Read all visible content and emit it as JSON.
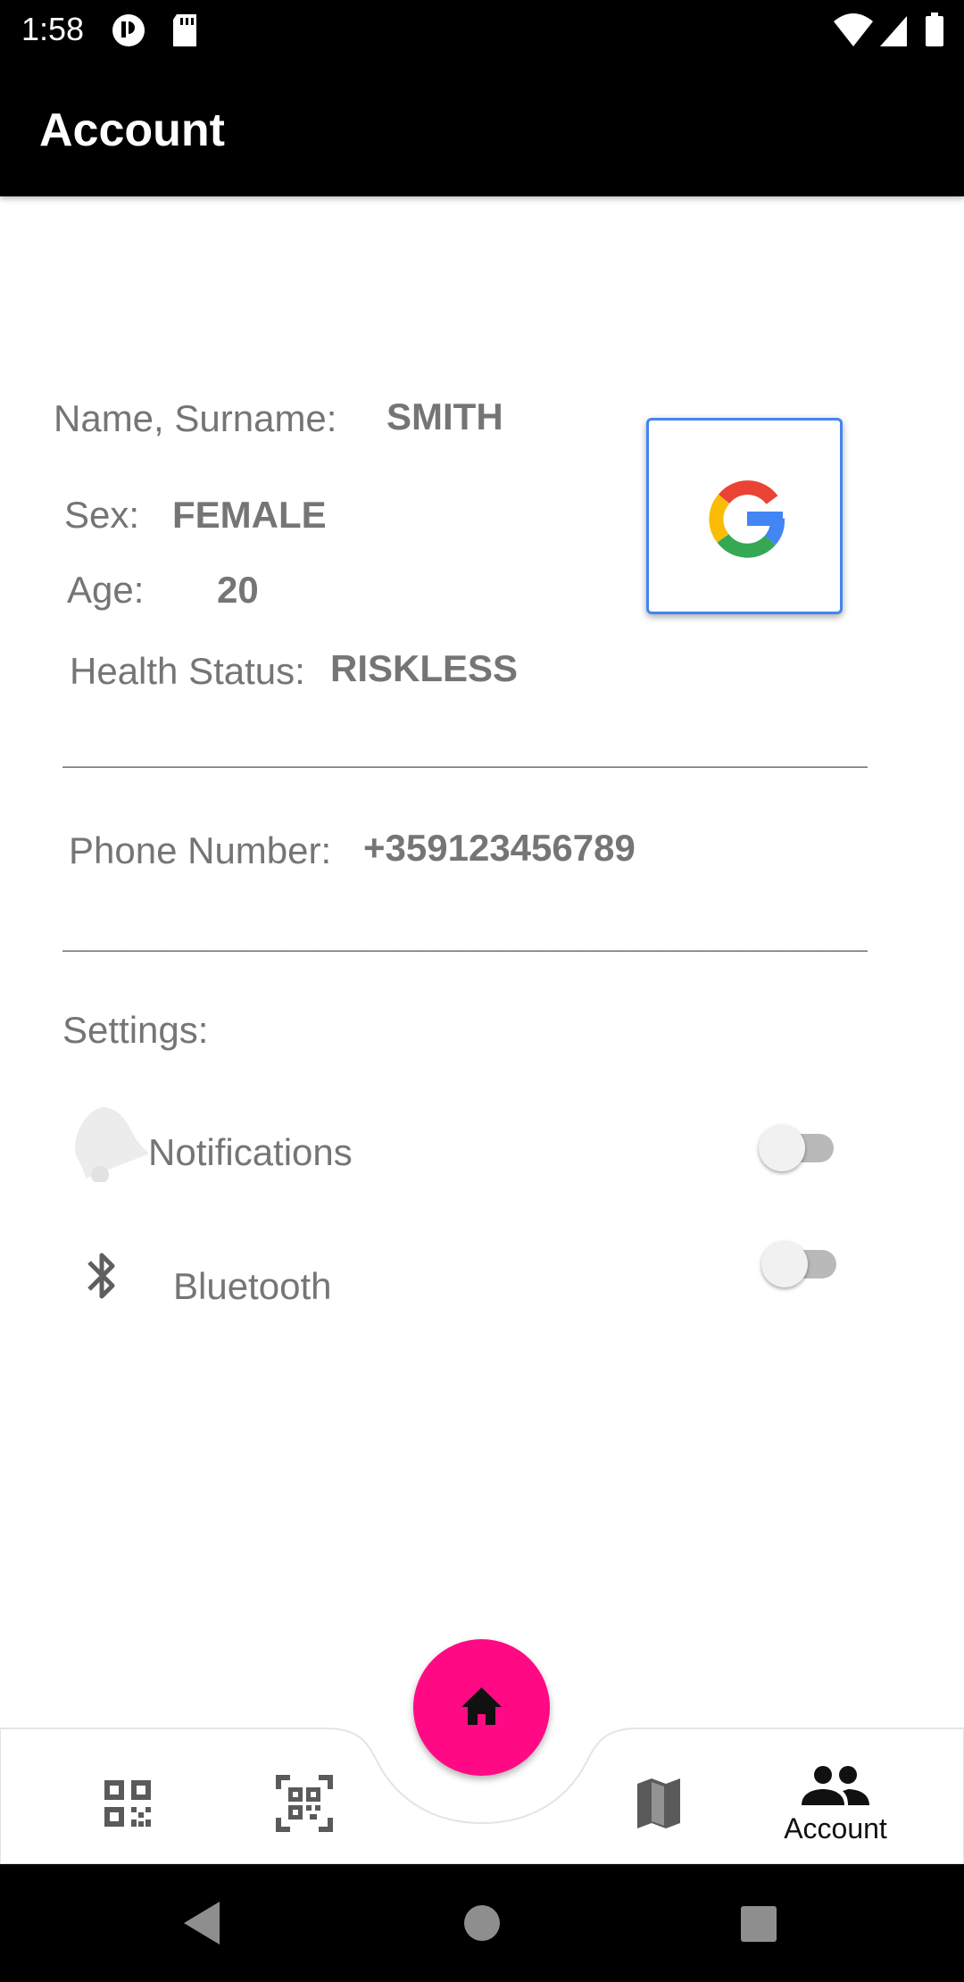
{
  "status_bar": {
    "time": "1:58"
  },
  "app_bar": {
    "title": "Account"
  },
  "profile": {
    "name_label": "Name, Surname:",
    "name_value": "SMITH",
    "sex_label": "Sex:",
    "sex_value": "FEMALE",
    "age_label": "Age:",
    "age_value": "20",
    "health_label": "Health Status:",
    "health_value": "RISKLESS",
    "phone_label": "Phone Number:",
    "phone_value": "+359123456789",
    "divider": "_____________________________________________"
  },
  "settings": {
    "title": "Settings:",
    "items": [
      {
        "label": "Notifications",
        "icon": "bell-icon",
        "enabled": false
      },
      {
        "label": "Bluetooth",
        "icon": "bluetooth-icon",
        "enabled": false
      }
    ]
  },
  "bottom_nav": {
    "items": [
      {
        "icon": "qr-code-icon"
      },
      {
        "icon": "qr-scan-icon"
      },
      {
        "icon": "map-icon"
      },
      {
        "icon": "people-icon",
        "label": "Account",
        "selected": true
      }
    ],
    "fab_icon": "home-icon"
  },
  "colors": {
    "fab": "#FF0A84",
    "google_border": "#4285F4",
    "bars": "#000000"
  }
}
